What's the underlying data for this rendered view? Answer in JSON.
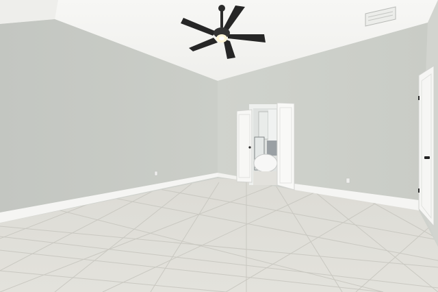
{
  "scene": {
    "type": "photo",
    "room": "empty bedroom",
    "elements": [
      "ceiling-fan",
      "double-door",
      "bathroom-view",
      "freestanding-bathtub",
      "tile-floor",
      "air-vent",
      "closet-door"
    ],
    "colors": {
      "ceiling": "#f4f4f2",
      "left_wall": "#c6c9c4",
      "back_wall": "#cdd0ca",
      "right_wall": "#d4d6d1",
      "floor": "#dddcd6",
      "baseboard": "#f6f6f4",
      "door": "#f8f8f6",
      "fan_blade": "#2a2a2a"
    }
  }
}
